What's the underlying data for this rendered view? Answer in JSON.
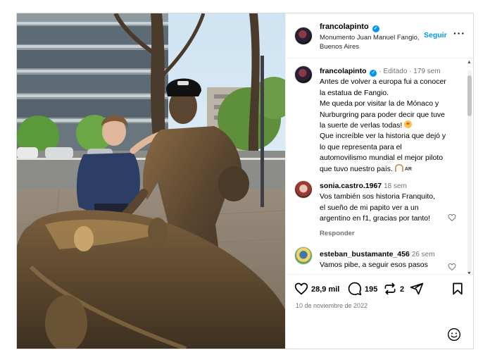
{
  "post": {
    "username": "francolapinto",
    "location": "Monumento Juan Manuel Fangio, Buenos Aires",
    "follow_label": "Seguir",
    "more_label": "···"
  },
  "caption": {
    "username": "francolapinto",
    "edited": "Editado",
    "time": "179 sem",
    "lines": [
      "Antes de volver a europa fui a conocer",
      "la estatua de Fangio.",
      "Me queda por visitar la de Mónaco y",
      "Nurburgring para poder decir que tuve",
      "la suerte de verlas todas!",
      "Que increíble ver la historia que dejó y",
      "lo que representa para el",
      "automovilismo mundial el mejor piloto",
      "que tuvo nuestro país."
    ],
    "flag": "AR"
  },
  "comments": [
    {
      "username": "sonia.castro.1967",
      "time": "18 sem",
      "lines": [
        "Vos también sos historia Franquito,",
        "el sueño de mi papito ver a un",
        "argentino en f1, gracias por tanto!"
      ],
      "reply_label": "Responder"
    },
    {
      "username": "esteban_bustamante_456",
      "time": "26 sem",
      "lines": [
        "Vamos pibe, a seguir esos pasos"
      ]
    }
  ],
  "actions": {
    "likes": "28,9 mil",
    "comments": "195",
    "reposts": "2",
    "date": "10 de noviembre de 2022"
  },
  "icons": {
    "verified": "verified-badge-icon",
    "like": "heart-icon",
    "comment": "comment-bubble-icon",
    "repost": "repost-icon",
    "share": "share-paper-plane-icon",
    "save": "bookmark-icon",
    "emoji": "emoji-smiley-icon"
  },
  "colors": {
    "accent": "#0095f6",
    "muted": "#737373",
    "border": "#dbdbdb"
  }
}
